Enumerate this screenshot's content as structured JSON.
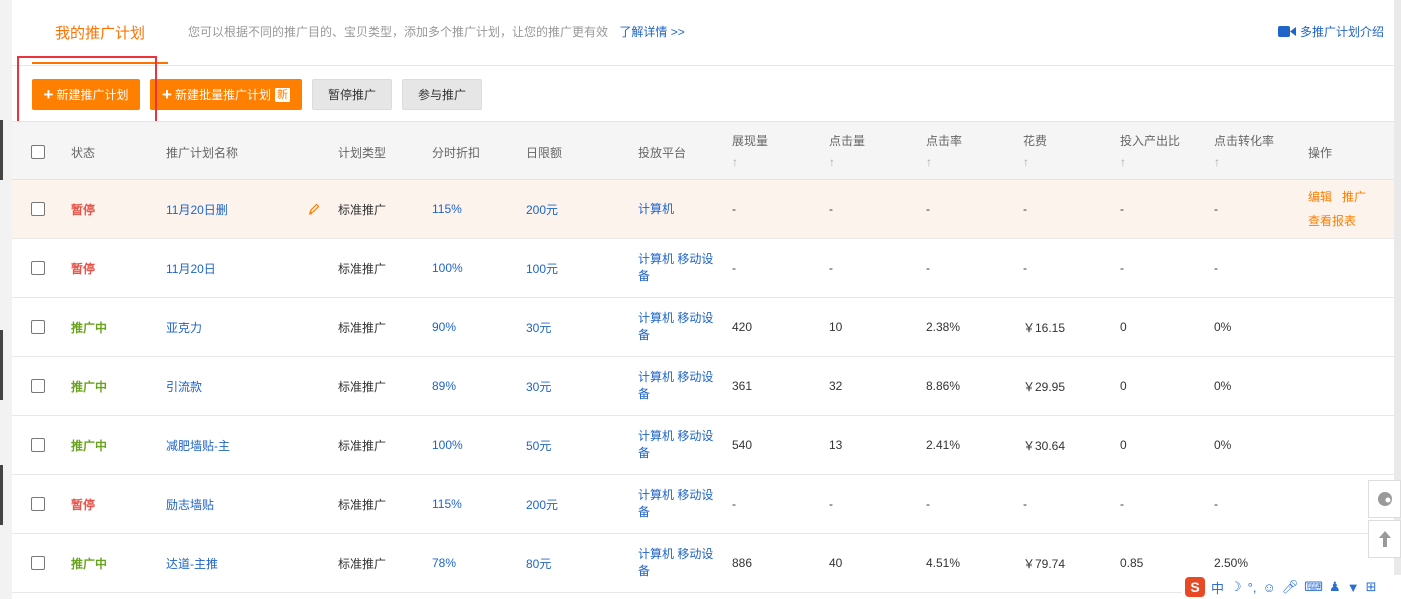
{
  "tab": {
    "active_label": "我的推广计划",
    "description": "您可以根据不同的推广目的、宝贝类型，添加多个推广计划，让您的推广更有效",
    "learn_more": "了解详情 >>",
    "intro_label": "多推广计划介绍"
  },
  "toolbar": {
    "new_plan": "新建推广计划",
    "new_batch": "新建批量推广计划",
    "new_badge": "新",
    "pause": "暂停推广",
    "join": "参与推广"
  },
  "table": {
    "headers": {
      "status": "状态",
      "name": "推广计划名称",
      "type": "计划类型",
      "discount": "分时折扣",
      "limit": "日限额",
      "platform": "投放平台",
      "impressions": "展现量",
      "clicks": "点击量",
      "ctr": "点击率",
      "cost": "花费",
      "roi": "投入产出比",
      "cvr": "点击转化率",
      "ops": "操作",
      "sort_arrow": "↑"
    },
    "rows": [
      {
        "status": "暂停",
        "name": "11月20日删",
        "type": "标准推广",
        "discount": "115%",
        "limit": "200元",
        "platform": "计算机",
        "impressions": "-",
        "clicks": "-",
        "ctr": "-",
        "cost": "-",
        "roi": "-",
        "cvr": "-",
        "op_edit": "编辑",
        "op_promote": "推广",
        "op_report": "查看报表"
      },
      {
        "status": "暂停",
        "name": "11月20日",
        "type": "标准推广",
        "discount": "100%",
        "limit": "100元",
        "platform": "计算机 移动设备",
        "impressions": "-",
        "clicks": "-",
        "ctr": "-",
        "cost": "-",
        "roi": "-",
        "cvr": "-"
      },
      {
        "status": "推广中",
        "name": "亚克力",
        "type": "标准推广",
        "discount": "90%",
        "limit": "30元",
        "platform": "计算机 移动设备",
        "impressions": "420",
        "clicks": "10",
        "ctr": "2.38%",
        "cost": "￥16.15",
        "roi": "0",
        "cvr": "0%"
      },
      {
        "status": "推广中",
        "name": "引流款",
        "type": "标准推广",
        "discount": "89%",
        "limit": "30元",
        "platform": "计算机 移动设备",
        "impressions": "361",
        "clicks": "32",
        "ctr": "8.86%",
        "cost": "￥29.95",
        "roi": "0",
        "cvr": "0%"
      },
      {
        "status": "推广中",
        "name": "减肥墙贴-主",
        "type": "标准推广",
        "discount": "100%",
        "limit": "50元",
        "platform": "计算机 移动设备",
        "impressions": "540",
        "clicks": "13",
        "ctr": "2.41%",
        "cost": "￥30.64",
        "roi": "0",
        "cvr": "0%"
      },
      {
        "status": "暂停",
        "name": "励志墙贴",
        "type": "标准推广",
        "discount": "115%",
        "limit": "200元",
        "platform": "计算机 移动设备",
        "impressions": "-",
        "clicks": "-",
        "ctr": "-",
        "cost": "-",
        "roi": "-",
        "cvr": "-"
      },
      {
        "status": "推广中",
        "name": "达道-主推",
        "type": "标准推广",
        "discount": "78%",
        "limit": "80元",
        "platform": "计算机 移动设备",
        "impressions": "886",
        "clicks": "40",
        "ctr": "4.51%",
        "cost": "￥79.74",
        "roi": "0.85",
        "cvr": "2.50%"
      }
    ]
  },
  "ime": {
    "lang": "中"
  },
  "colors": {
    "accent": "#ff7f00",
    "link": "#1f64c8",
    "paused": "#e8534a",
    "running": "#6aa320",
    "highlight_box": "#e8343a"
  },
  "icons": [
    "video-icon",
    "pencil-icon",
    "feedback-icon",
    "back-to-top-icon",
    "sogou-ime-logo"
  ]
}
